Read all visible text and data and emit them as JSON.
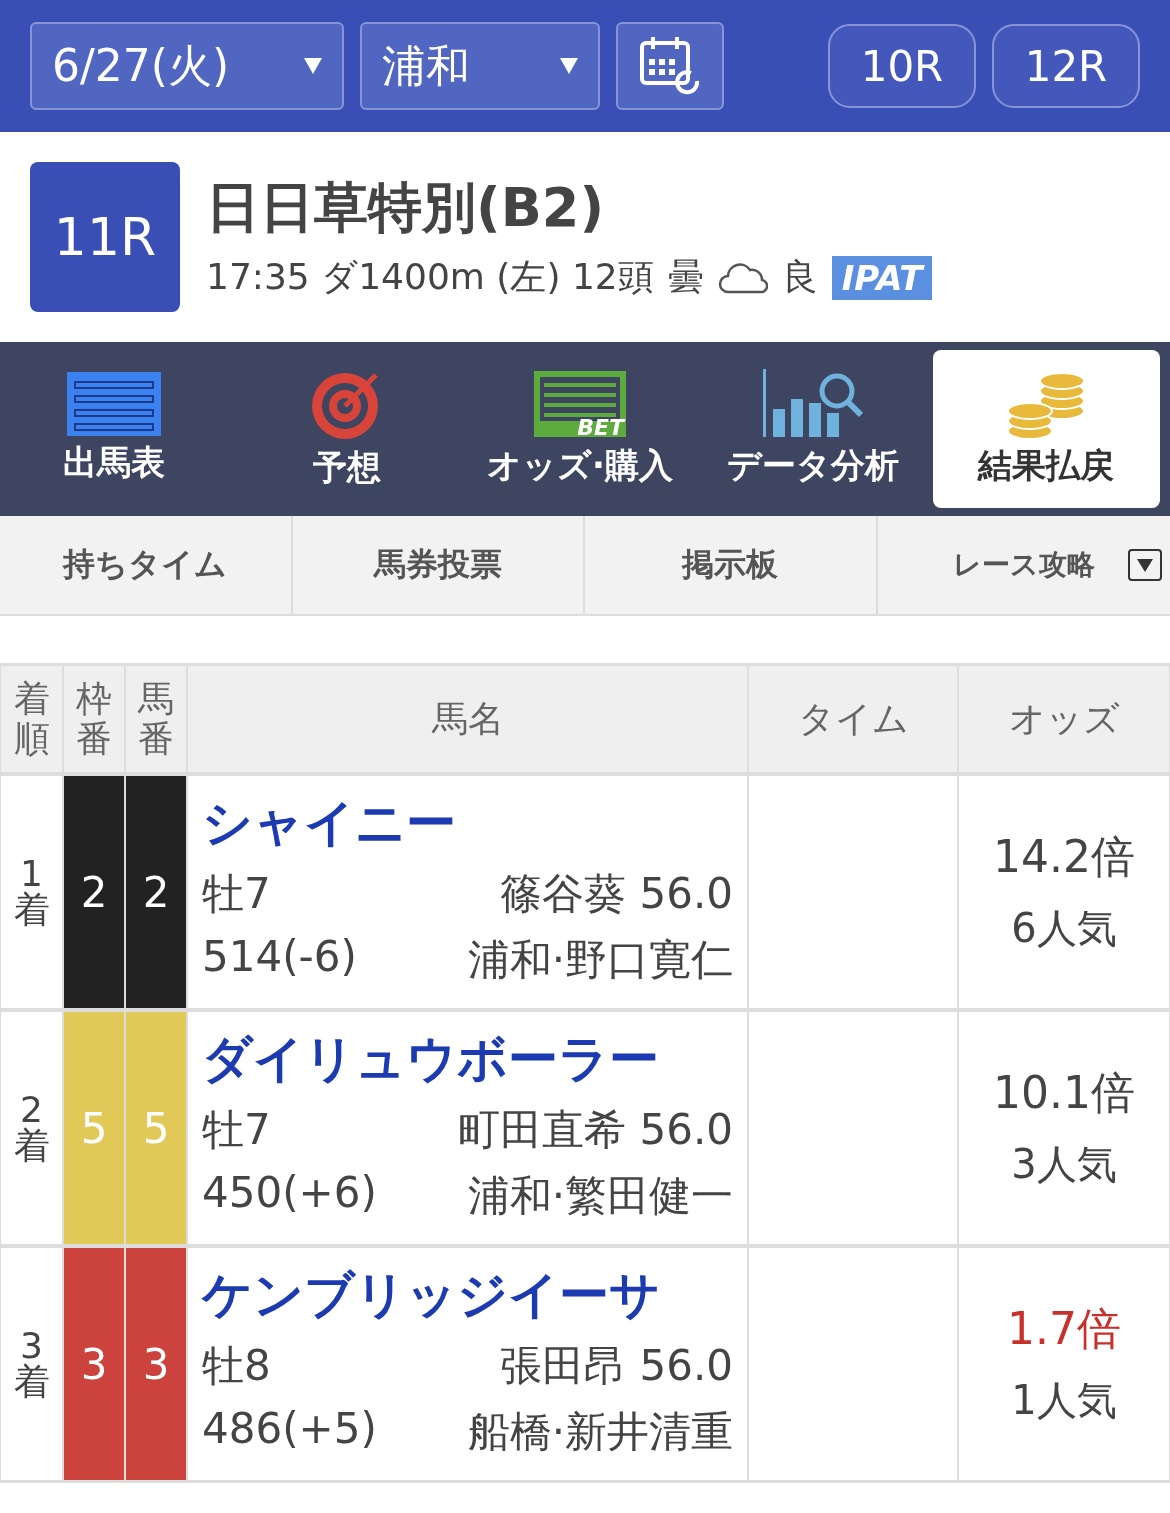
{
  "header": {
    "date": "6/27(火)",
    "venue": "浦和",
    "prev_race": "10R",
    "next_race": "12R"
  },
  "race": {
    "number": "11R",
    "name": "日日草特別(B2)",
    "time": "17:35",
    "course": "ダ1400m",
    "direction": "(左)",
    "runners": "12頭",
    "weather": "曇",
    "going": "良",
    "badge": "IPAT"
  },
  "nav": [
    {
      "label": "出馬表",
      "kind": "list",
      "selected": false
    },
    {
      "label": "予想",
      "kind": "target",
      "selected": false
    },
    {
      "label": "オッズ·購入",
      "kind": "bet",
      "icon_text": "BET",
      "selected": false
    },
    {
      "label": "データ分析",
      "kind": "chart",
      "selected": false
    },
    {
      "label": "結果払戻",
      "kind": "coins",
      "selected": true
    }
  ],
  "subtabs": [
    {
      "label": "持ちタイム",
      "kind": "plain"
    },
    {
      "label": "馬券投票",
      "kind": "plain"
    },
    {
      "label": "掲示板",
      "kind": "plain"
    },
    {
      "label": "レース攻略",
      "kind": "dropdown"
    }
  ],
  "table": {
    "columns": [
      "着順",
      "枠番",
      "馬番",
      "馬名",
      "タイム",
      "オッズ"
    ],
    "rows": [
      {
        "place": "1",
        "place_suffix": "着",
        "frame": "2",
        "number": "2",
        "color": "#222222",
        "horse": "シャイニー",
        "sex_age": "牡7",
        "jockey": "篠谷葵 56.0",
        "weight": "514(-6)",
        "trainer": "浦和·野口寛仁",
        "odds": "14.2倍",
        "popularity": "6人気",
        "favorite": false
      },
      {
        "place": "2",
        "place_suffix": "着",
        "frame": "5",
        "number": "5",
        "color": "#e0c957",
        "horse": "ダイリュウボーラー",
        "sex_age": "牡7",
        "jockey": "町田直希 56.0",
        "weight": "450(+6)",
        "trainer": "浦和·繁田健一",
        "odds": "10.1倍",
        "popularity": "3人気",
        "favorite": false
      },
      {
        "place": "3",
        "place_suffix": "着",
        "frame": "3",
        "number": "3",
        "color": "#cc433d",
        "horse": "ケンブリッジイーサ",
        "sex_age": "牡8",
        "jockey": "張田昂 56.0",
        "weight": "486(+5)",
        "trainer": "船橋·新井清重",
        "odds": "1.7倍",
        "popularity": "1人気",
        "favorite": true
      }
    ]
  }
}
